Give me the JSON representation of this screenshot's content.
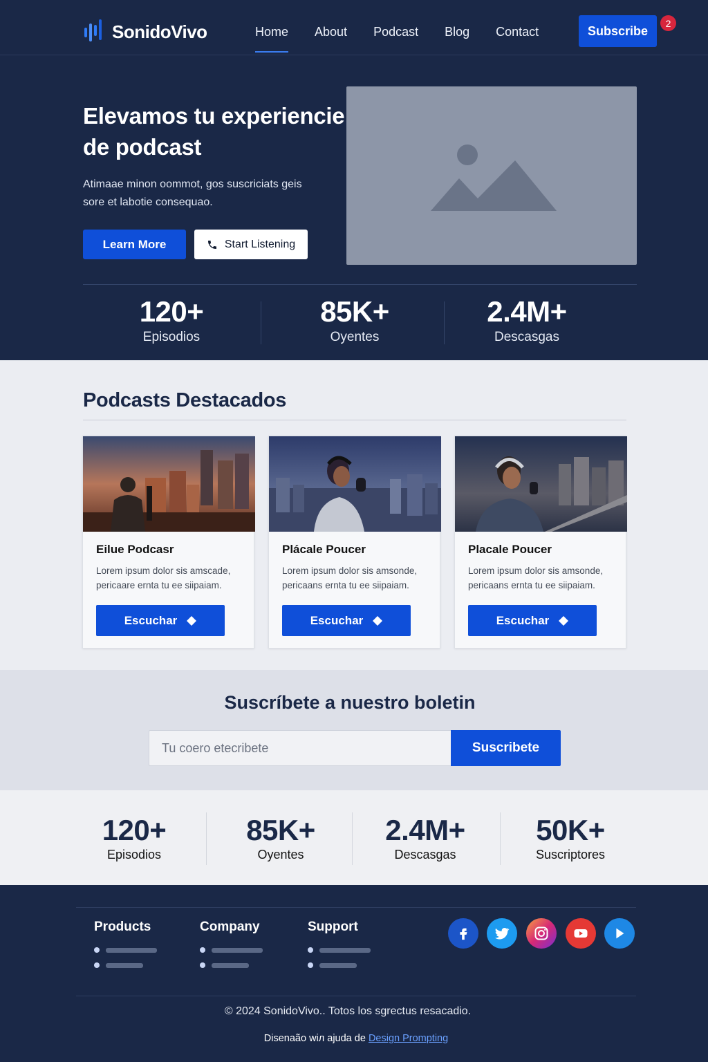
{
  "brand": {
    "name": "SonidoVivo",
    "accent": "#0f4fd9",
    "background": "#1a2847"
  },
  "nav": {
    "links": [
      {
        "label": "Home",
        "active": true
      },
      {
        "label": "About",
        "active": false
      },
      {
        "label": "Podcast",
        "active": false
      },
      {
        "label": "Blog",
        "active": false
      },
      {
        "label": "Contact",
        "active": false
      }
    ],
    "subscribe_label": "Subscribe",
    "badge_count": "2"
  },
  "hero": {
    "title": "Elevamos tu experiencie de podcast",
    "description": "Atimaae minon oommot, gos suscriciats geis sore et labotie consequao.",
    "learn_more_label": "Learn More",
    "start_listening_label": "Start Listening",
    "image_icon": "image-placeholder-icon",
    "stats": [
      {
        "value": "120+",
        "label": "Episodios"
      },
      {
        "value": "85K+",
        "label": "Oyentes"
      },
      {
        "value": "2.4M+",
        "label": "Descasgas"
      }
    ]
  },
  "featured": {
    "title": "Podcasts Destacados",
    "cards": [
      {
        "title": "Eilue Podcasr",
        "description": "Lorem ipsum dolor sis amscade, pericaare ernta tu ee siipaiam.",
        "button_label": "Escuchar"
      },
      {
        "title": "Plácale Poucer",
        "description": "Lorem ipsum dolor sis amsonde, pericaans ernta tu ee siipaiam.",
        "button_label": "Escuchar"
      },
      {
        "title": "Placale Poucer",
        "description": "Lorem ipsum dolor sis amsonde, pericaans ernta tu ee siipaiam.",
        "button_label": "Escuchar"
      }
    ]
  },
  "newsletter": {
    "title": "Suscríbete a nuestro boletin",
    "placeholder": "Tu coero etecribete",
    "button_label": "Suscribete"
  },
  "stats_band": [
    {
      "value": "120+",
      "label": "Episodios"
    },
    {
      "value": "85K+",
      "label": "Oyentes"
    },
    {
      "value": "2.4M+",
      "label": "Descasgas"
    },
    {
      "value": "50K+",
      "label": "Suscriptores"
    }
  ],
  "footer": {
    "columns": [
      {
        "title": "Products"
      },
      {
        "title": "Company"
      },
      {
        "title": "Support"
      }
    ],
    "social": [
      {
        "icon": "facebook-icon",
        "color": "#1877f2"
      },
      {
        "icon": "twitter-icon",
        "color": "#1d9bf0"
      },
      {
        "icon": "instagram-icon",
        "color": "#d62976"
      },
      {
        "icon": "youtube-icon",
        "color": "#e53935"
      },
      {
        "icon": "play-icon",
        "color": "#1e88e5"
      }
    ],
    "copyright": "© 2024 SonidoVivo.. Totos los sgrectus resacadio.",
    "credit_prefix": "Disenaão wiл ajuda de ",
    "credit_link": "Design Prompting"
  }
}
